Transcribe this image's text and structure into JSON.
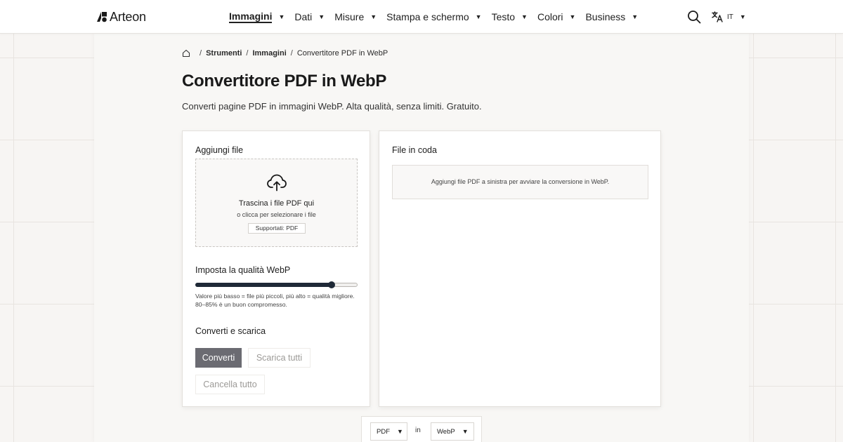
{
  "brand": {
    "name": "Arteon"
  },
  "nav": {
    "items": [
      {
        "label": "Immagini",
        "active": true
      },
      {
        "label": "Dati"
      },
      {
        "label": "Misure"
      },
      {
        "label": "Stampa e schermo"
      },
      {
        "label": "Testo"
      },
      {
        "label": "Colori"
      },
      {
        "label": "Business"
      }
    ],
    "language": "IT",
    "caret": "▼"
  },
  "breadcrumb": {
    "sep": "/",
    "items": [
      "Strumenti",
      "Immagini"
    ],
    "current": "Convertitore PDF in WebP"
  },
  "page": {
    "title": "Convertitore PDF in WebP",
    "subtitle": "Converti pagine PDF in immagini WebP. Alta qualità, senza limiti. Gratuito."
  },
  "upload": {
    "heading": "Aggiungi file",
    "drop_title": "Trascina i file PDF qui",
    "drop_sub": "o clicca per selezionare i file",
    "supported": "Supportati: PDF"
  },
  "quality": {
    "heading": "Imposta la qualità WebP",
    "value_percent": 84,
    "hint": "Valore più basso = file più piccoli, più alto = qualità migliore. 80–85% è un buon compromesso."
  },
  "actions": {
    "heading": "Converti e scarica",
    "convert": "Converti",
    "download_all": "Scarica tutti",
    "clear_all": "Cancella tutto"
  },
  "queue": {
    "heading": "File in coda",
    "empty": "Aggiungi file PDF a sinistra per avviare la conversione in WebP."
  },
  "format_bar": {
    "from": "PDF",
    "joiner": "in",
    "to": "WebP"
  },
  "colors": {
    "accent": "#1f2937",
    "primary_button": "#6b6b72",
    "page_bg": "#f7f5f3"
  }
}
